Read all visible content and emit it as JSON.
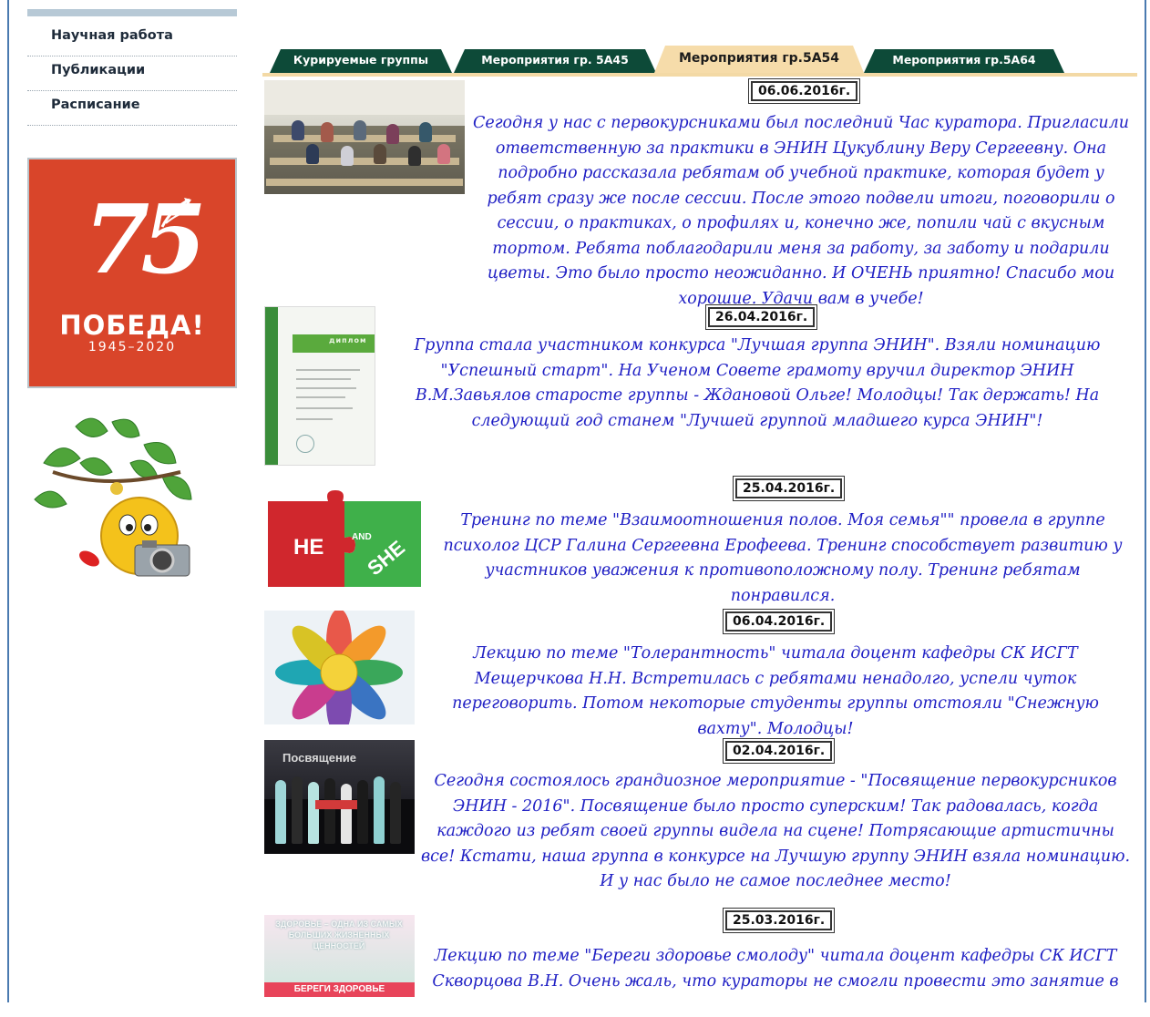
{
  "nav": {
    "items": [
      {
        "label": "Научная работа"
      },
      {
        "label": "Публикации"
      },
      {
        "label": "Расписание"
      }
    ]
  },
  "banner": {
    "number": "75",
    "word": "ПОБЕДА!",
    "years": "1945–2020",
    "color": "#d9452a"
  },
  "tabs": [
    {
      "label": "Курируемые группы",
      "active": false
    },
    {
      "label": "Мероприятия гр. 5А45",
      "active": false
    },
    {
      "label": "Мероприятия гр.5А54",
      "active": true
    },
    {
      "label": "Мероприятия гр.5А64",
      "active": false
    }
  ],
  "posts": [
    {
      "date": "06.06.2016г.",
      "text": "Сегодня у нас с первокурсниками был последний Час куратора. Пригласили ответственную за практики в ЭНИН Цукублину Веру Сергеевну. Она подробно рассказала ребятам об учебной практике, которая будет у ребят сразу же после сессии. После этого подвели итоги, поговорили о сессии, о практиках, о профилях и, конечно же, попили чай с вкусным тортом. Ребята поблагодарили меня за работу, за заботу и подарили цветы. Это было просто неожиданно. И ОЧЕНЬ приятно! Спасибо мои хорошие. Удачи вам в учебе!"
    },
    {
      "date": "26.04.2016г.",
      "text": "Группа стала участником конкурса \"Лучшая группа ЭНИН\". Взяли номинацию \"Успешный старт\". На Ученом Совете грамоту вручил директор ЭНИН В.М.Завьялов старосте группы - Ждановой Ольге! Молодцы! Так держать! На следующий год станем \"Лучшей группой младшего курса ЭНИН\"!",
      "thumb": {
        "band": "диплом"
      }
    },
    {
      "date": "25.04.2016г.",
      "text": "Тренинг по теме \"Взаимоотношения полов. Моя семья\"\" провела в группе психолог ЦСР Галина Сергеевна Ерофеева. Тренинг способствует развитию у участников уважения к противоположному полу. Тренинг ребятам понравился.",
      "thumb": {
        "left": "HE",
        "mid": "AND",
        "right": "SHE"
      }
    },
    {
      "date": "06.04.2016г.",
      "text": "Лекцию по теме \"Толерантность\" читала доцент кафедры СК ИСГТ Мещерчкова Н.Н. Встретилась с ребятами ненадолго, успели чуток переговорить. Потом некоторые студенты группы отстояли \"Снежную вахту\". Молодцы!"
    },
    {
      "date": "02.04.2016г.",
      "text": "Сегодня состоялось грандиозное мероприятие - \"Посвящение первокурсников ЭНИН - 2016\". Посвящение было просто суперским! Так радовалась, когда каждого из ребят своей группы видела на сцене! Потрясающие артистичны все! Кстати, наша группа в конкурсе на Лучшую группу ЭНИН взяла номинацию. И у нас было не самое последнее место!",
      "thumb": {
        "sign": "Посвящение"
      }
    },
    {
      "date": "25.03.2016г.",
      "text": "Лекцию по теме \"Береги здоровье смолоду\" читала доцент кафедры СК ИСГТ Скворцова В.Н. Очень жаль, что кураторы не смогли провести это занятие в",
      "thumb": {
        "caption": "ЗДОРОВЬЕ – ОДНА ИЗ САМЫХ БОЛЬШИХ ЖИЗНЕННЫХ ЦЕННОСТЕЙ",
        "bottom": "БЕРЕГИ ЗДОРОВЬЕ"
      }
    }
  ]
}
